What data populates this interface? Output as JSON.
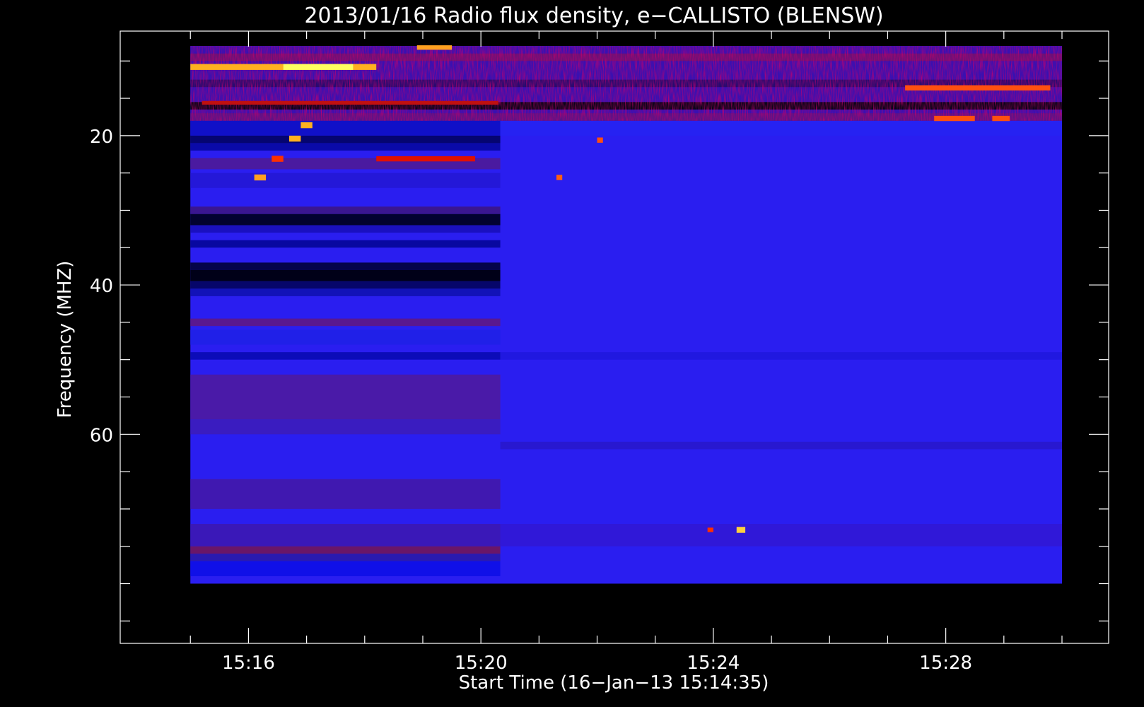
{
  "chart_data": {
    "type": "heatmap",
    "title": "2013/01/16  Radio flux density, e−CALLISTO (BLENSW)",
    "xlabel": "Start Time (16−Jan−13 15:14:35)",
    "ylabel": "Frequency (MHZ)",
    "x_start": "15:14:35",
    "x_end": "15:30:00",
    "ylim": [
      88,
      6
    ],
    "x_ticks": [
      {
        "label": "15:16",
        "minutes": 16
      },
      {
        "label": "15:20",
        "minutes": 20
      },
      {
        "label": "15:24",
        "minutes": 24
      },
      {
        "label": "15:28",
        "minutes": 28
      }
    ],
    "y_ticks": [
      {
        "label": "20",
        "value": 20
      },
      {
        "label": "40",
        "value": 40
      },
      {
        "label": "60",
        "value": 60
      }
    ],
    "frequency_range_mhz": [
      8,
      80
    ],
    "time_range": [
      "15:15:00",
      "15:30:00"
    ],
    "colormap": [
      "#000000",
      "#0000ff",
      "#800000",
      "#ff0000",
      "#ffa500",
      "#ffff00"
    ],
    "background_color": "#000000",
    "notes": "Dynamic spectrum; strong RFI bands near 8-18 MHz, weaker band changes before 15:20:20"
  }
}
